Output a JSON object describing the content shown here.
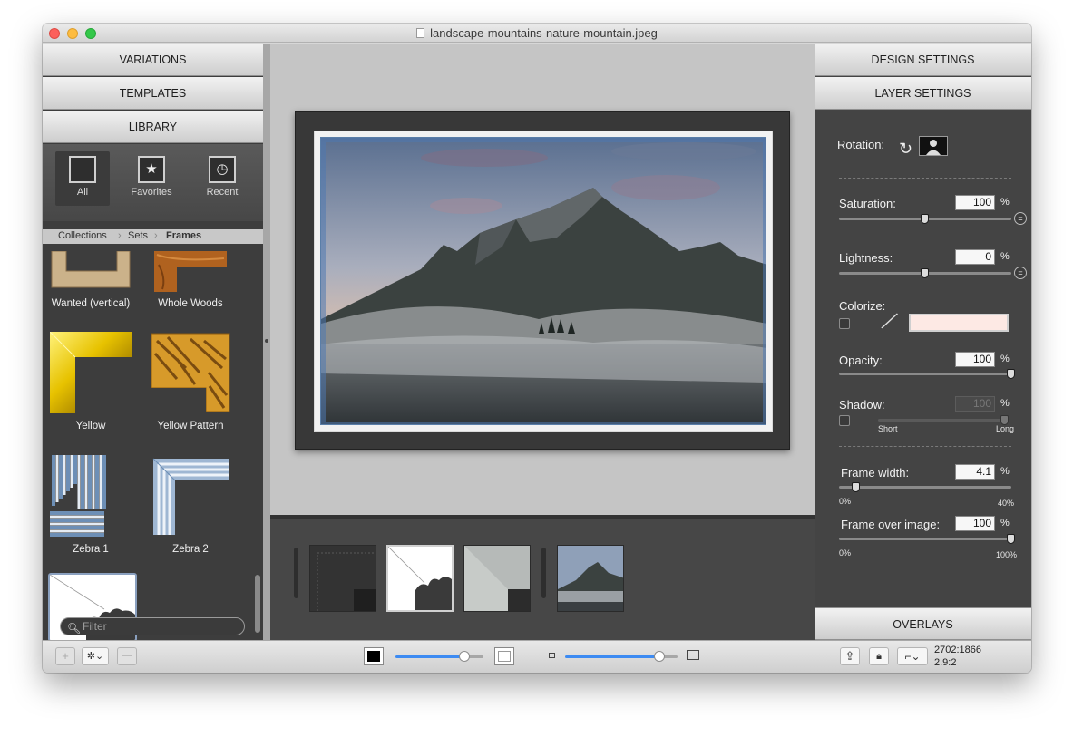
{
  "window": {
    "title": "landscape-mountains-nature-mountain.jpeg"
  },
  "left_panel": {
    "sections": [
      "VARIATIONS",
      "TEMPLATES",
      "LIBRARY"
    ],
    "segments": [
      {
        "label": "All",
        "icon": "square-icon",
        "active": true
      },
      {
        "label": "Favorites",
        "icon": "star-icon",
        "active": false
      },
      {
        "label": "Recent",
        "icon": "clock-icon",
        "active": false
      }
    ],
    "breadcrumb": [
      "Collections",
      "Sets",
      "Frames"
    ],
    "items": [
      {
        "label": "Wanted (vertical)"
      },
      {
        "label": "Whole Woods"
      },
      {
        "label": "Yellow"
      },
      {
        "label": "Yellow Pattern"
      },
      {
        "label": "Zebra 1"
      },
      {
        "label": "Zebra 2"
      }
    ],
    "filter_placeholder": "Filter"
  },
  "right_panel": {
    "sections": [
      "DESIGN SETTINGS",
      "LAYER SETTINGS"
    ],
    "rotation_label": "Rotation:",
    "saturation": {
      "label": "Saturation:",
      "value": "100",
      "unit": "%",
      "level": 0.5
    },
    "lightness": {
      "label": "Lightness:",
      "value": "0",
      "unit": "%",
      "level": 0.5
    },
    "colorize": {
      "label": "Colorize:",
      "swatch": "#fde9e4"
    },
    "opacity": {
      "label": "Opacity:",
      "value": "100",
      "unit": "%",
      "level": 1.0
    },
    "shadow": {
      "label": "Shadow:",
      "value": "100",
      "unit": "%",
      "min_label": "Short",
      "max_label": "Long",
      "level": 1.0
    },
    "frame_width": {
      "label": "Frame width:",
      "value": "4.1",
      "unit": "%",
      "min_label": "0%",
      "max_label": "40%",
      "level": 0.1
    },
    "frame_over_image": {
      "label": "Frame over image:",
      "value": "100",
      "unit": "%",
      "min_label": "0%",
      "max_label": "100%",
      "level": 1.0
    },
    "overlays": "OVERLAYS"
  },
  "bottom_bar": {
    "add_label": "+",
    "gear_label": "✲⌄",
    "remove_label": "—",
    "dims_line1": "2702:1866",
    "dims_line2": "2.9:2"
  },
  "colors": {
    "accent_blue": "#3d8bf2",
    "panel_dark": "#444444"
  }
}
